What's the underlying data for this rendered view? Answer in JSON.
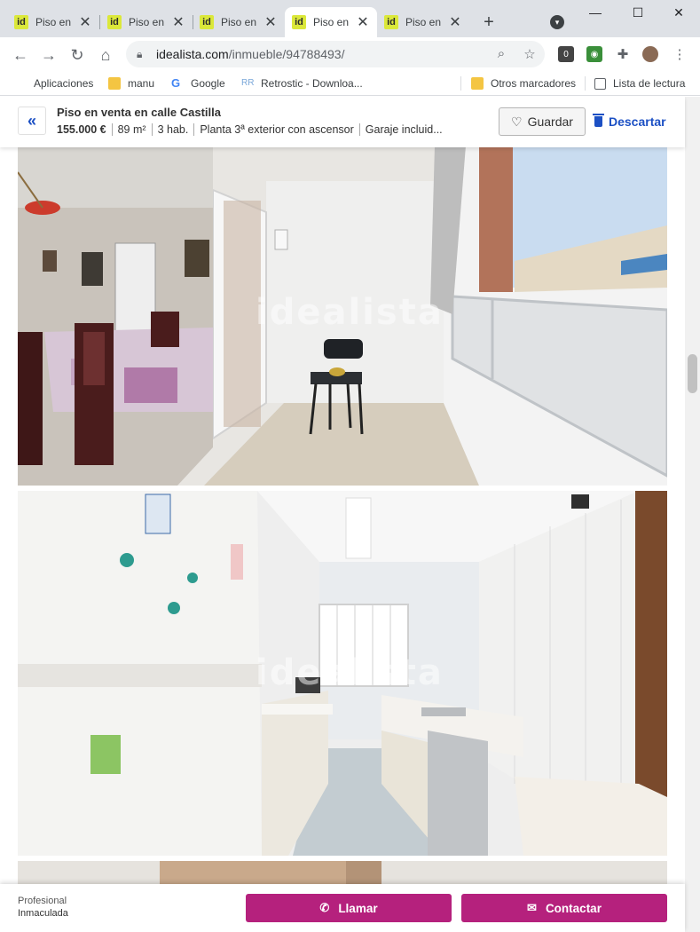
{
  "browser": {
    "tabs": [
      {
        "favicon": "id",
        "label": "Piso en",
        "active": false
      },
      {
        "favicon": "id",
        "label": "Piso en",
        "active": false
      },
      {
        "favicon": "id",
        "label": "Piso en",
        "active": false
      },
      {
        "favicon": "id",
        "label": "Piso en",
        "active": true
      },
      {
        "favicon": "id",
        "label": "Piso en",
        "active": false
      }
    ],
    "url_host": "idealista.com",
    "url_path": "/inmueble/94788493/",
    "bookmarks": [
      {
        "label": "Aplicaciones",
        "icon": "apps-grid-icon"
      },
      {
        "label": "manu",
        "icon": "folder-icon"
      },
      {
        "label": "Google",
        "icon": "google-icon"
      },
      {
        "label": "Retrostic - Downloa...",
        "icon": "retrostic-icon"
      }
    ],
    "other_bookmarks": "Otros marcadores",
    "reading_list": "Lista de lectura"
  },
  "listing": {
    "title": "Piso en venta en calle Castilla",
    "facts": [
      "155.000 €",
      "89 m²",
      "3 hab.",
      "Planta 3ª exterior con ascensor",
      "Garaje incluid..."
    ],
    "save_label": "Guardar",
    "discard_label": "Descartar",
    "watermark": "idealista"
  },
  "contact": {
    "agent_line1": "Profesional",
    "agent_line2": "Inmaculada",
    "call_label": "Llamar",
    "contact_label": "Contactar"
  },
  "colors": {
    "accent_blue": "#1c50c4",
    "call_to_action": "#b5217d",
    "favicon_yellow": "#dbe83a"
  }
}
